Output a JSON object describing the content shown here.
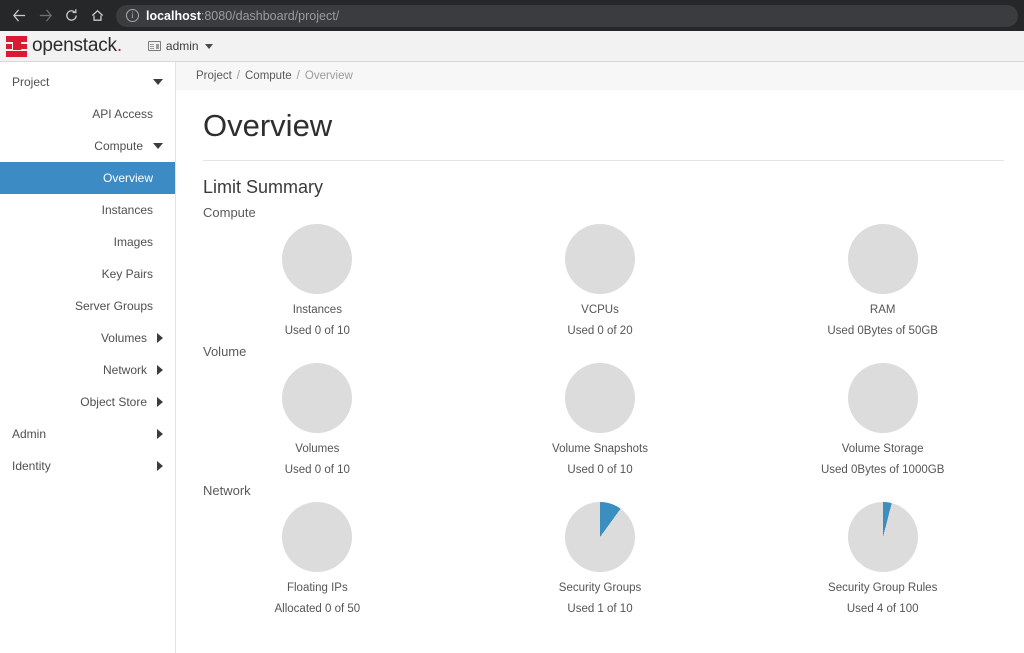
{
  "browser": {
    "back_icon": "back-arrow-icon",
    "forward_icon": "forward-arrow-icon",
    "reload_icon": "reload-icon",
    "home_icon": "home-icon",
    "info_icon": "info-icon",
    "url_host": "localhost",
    "url_rest": ":8080/dashboard/project/"
  },
  "topbar": {
    "logo_icon": "openstack-logo-icon",
    "brand": "openstack",
    "brand_dot": ".",
    "tenant_icon": "id-card-icon",
    "tenant_label": "admin",
    "caret_icon": "caret-down-icon"
  },
  "sidebar": {
    "items": [
      {
        "label": "Project",
        "level": 0,
        "chevron": "down",
        "active": false
      },
      {
        "label": "API Access",
        "level": 1,
        "chevron": "none",
        "active": false
      },
      {
        "label": "Compute",
        "level": 1,
        "chevron": "down",
        "active": false
      },
      {
        "label": "Overview",
        "level": 2,
        "chevron": "none",
        "active": true
      },
      {
        "label": "Instances",
        "level": 2,
        "chevron": "none",
        "active": false
      },
      {
        "label": "Images",
        "level": 2,
        "chevron": "none",
        "active": false
      },
      {
        "label": "Key Pairs",
        "level": 2,
        "chevron": "none",
        "active": false
      },
      {
        "label": "Server Groups",
        "level": 2,
        "chevron": "none",
        "active": false
      },
      {
        "label": "Volumes",
        "level": 1,
        "chevron": "right",
        "active": false
      },
      {
        "label": "Network",
        "level": 1,
        "chevron": "right",
        "active": false
      },
      {
        "label": "Object Store",
        "level": 1,
        "chevron": "right",
        "active": false
      },
      {
        "label": "Admin",
        "level": 0,
        "chevron": "right",
        "active": false
      },
      {
        "label": "Identity",
        "level": 0,
        "chevron": "right",
        "active": false
      }
    ]
  },
  "breadcrumb": {
    "items": [
      "Project",
      "Compute",
      "Overview"
    ],
    "separator": "/"
  },
  "page": {
    "title": "Overview",
    "section_title": "Limit Summary"
  },
  "colors": {
    "accent_blue": "#3d8bc4",
    "slice_blue": "#3a8ec0",
    "donut_gray": "#dcdcdc",
    "brand_red": "#da1a32"
  },
  "chart_data": [
    {
      "type": "pie",
      "group": "Compute",
      "charts": [
        {
          "title": "Instances",
          "value_label": "Used 0 of 10",
          "used": 0,
          "limit": 10,
          "percent": 0
        },
        {
          "title": "VCPUs",
          "value_label": "Used 0 of 20",
          "used": 0,
          "limit": 20,
          "percent": 0
        },
        {
          "title": "RAM",
          "value_label": "Used 0Bytes of 50GB",
          "used": 0,
          "limit": 50,
          "percent": 0
        }
      ]
    },
    {
      "type": "pie",
      "group": "Volume",
      "charts": [
        {
          "title": "Volumes",
          "value_label": "Used 0 of 10",
          "used": 0,
          "limit": 10,
          "percent": 0
        },
        {
          "title": "Volume Snapshots",
          "value_label": "Used 0 of 10",
          "used": 0,
          "limit": 10,
          "percent": 0
        },
        {
          "title": "Volume Storage",
          "value_label": "Used 0Bytes of 1000GB",
          "used": 0,
          "limit": 1000,
          "percent": 0
        }
      ]
    },
    {
      "type": "pie",
      "group": "Network",
      "charts": [
        {
          "title": "Floating IPs",
          "value_label": "Allocated 0 of 50",
          "used": 0,
          "limit": 50,
          "percent": 0
        },
        {
          "title": "Security Groups",
          "value_label": "Used 1 of 10",
          "used": 1,
          "limit": 10,
          "percent": 10
        },
        {
          "title": "Security Group Rules",
          "value_label": "Used 4 of 100",
          "used": 4,
          "limit": 100,
          "percent": 4
        }
      ]
    }
  ]
}
